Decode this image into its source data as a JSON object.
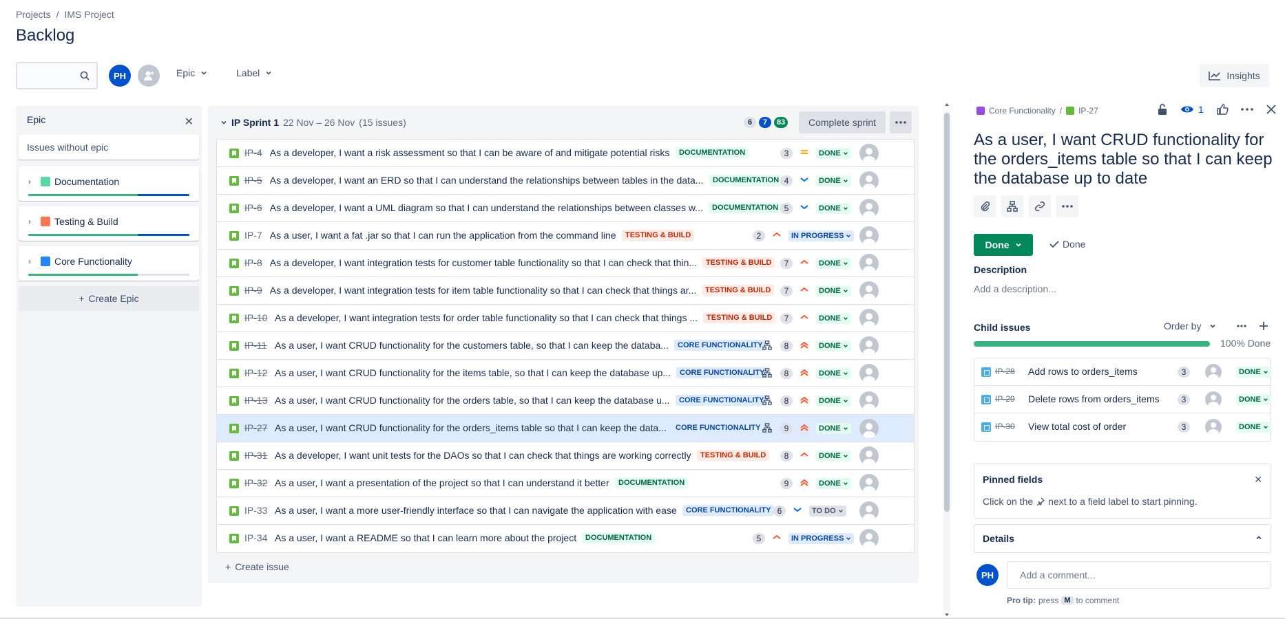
{
  "breadcrumb": {
    "projects": "Projects",
    "sep": "/",
    "project": "IMS Project"
  },
  "page_title": "Backlog",
  "toolbar": {
    "avatar_initials": "PH",
    "epic_filter": "Epic",
    "label_filter": "Label",
    "insights": "Insights"
  },
  "epic_panel": {
    "title": "Epic",
    "no_epic": "Issues without epic",
    "epics": [
      {
        "name": "Documentation",
        "color": "#57d9a3",
        "done": 0.68,
        "inprogress": 0.32
      },
      {
        "name": "Testing & Build",
        "color": "#ff7452",
        "done": 0.68,
        "inprogress": 0.32
      },
      {
        "name": "Core Functionality",
        "color": "#2684ff",
        "done": 0.68,
        "inprogress": 0.0
      }
    ],
    "create": "Create Epic"
  },
  "sprint": {
    "name": "IP Sprint 1",
    "dates": "22 Nov – 26 Nov",
    "count": "(15 issues)",
    "todo": "6",
    "inprogress": "7",
    "done": "83",
    "complete": "Complete sprint",
    "create_issue": "Create issue"
  },
  "issues": [
    {
      "key": "IP-4",
      "done": true,
      "summary": "As a developer, I want a risk assessment so that I can be aware of and mitigate potential risks",
      "epic": "DOCUMENTATION",
      "child": false,
      "points": "3",
      "prio": "medium",
      "status": "DONE"
    },
    {
      "key": "IP-5",
      "done": true,
      "summary": "As a developer, I want an ERD so that I can understand the relationships between tables in the data...",
      "epic": "DOCUMENTATION",
      "child": false,
      "points": "4",
      "prio": "low",
      "status": "DONE"
    },
    {
      "key": "IP-6",
      "done": true,
      "summary": "As a developer, I want a UML diagram so that I can understand the relationships between classes w...",
      "epic": "DOCUMENTATION",
      "child": false,
      "points": "5",
      "prio": "low",
      "status": "DONE"
    },
    {
      "key": "IP-7",
      "done": false,
      "summary": "As a user, I want a fat .jar so that I can run the application from the command line",
      "epic": "TESTING & BUILD",
      "child": false,
      "points": "2",
      "prio": "high",
      "status": "IN PROGRESS"
    },
    {
      "key": "IP-8",
      "done": true,
      "summary": "As a developer, I want integration tests for customer table functionality so that I can check that thin...",
      "epic": "TESTING & BUILD",
      "child": false,
      "points": "7",
      "prio": "high",
      "status": "DONE"
    },
    {
      "key": "IP-9",
      "done": true,
      "summary": "As a developer, I want integration tests for item table functionality so that I can check that things ar...",
      "epic": "TESTING & BUILD",
      "child": false,
      "points": "7",
      "prio": "high",
      "status": "DONE"
    },
    {
      "key": "IP-10",
      "done": true,
      "summary": "As a developer, I want integration tests for order table functionality so that I can check that things ...",
      "epic": "TESTING & BUILD",
      "child": false,
      "points": "7",
      "prio": "high",
      "status": "DONE"
    },
    {
      "key": "IP-11",
      "done": true,
      "summary": "As a user, I want CRUD functionality for the customers table, so that I can keep the databa...",
      "epic": "CORE FUNCTIONALITY",
      "child": true,
      "points": "8",
      "prio": "highest",
      "status": "DONE"
    },
    {
      "key": "IP-12",
      "done": true,
      "summary": "As a user, I want CRUD functionality for the items table, so that I can keep the database up...",
      "epic": "CORE FUNCTIONALITY",
      "child": true,
      "points": "8",
      "prio": "highest",
      "status": "DONE"
    },
    {
      "key": "IP-13",
      "done": true,
      "summary": "As a user, I want CRUD functionality for the orders table, so that I can keep the database u...",
      "epic": "CORE FUNCTIONALITY",
      "child": true,
      "points": "8",
      "prio": "highest",
      "status": "DONE"
    },
    {
      "key": "IP-27",
      "done": true,
      "summary": "As a user, I want CRUD functionality for the orders_items table so that I can keep the data...",
      "epic": "CORE FUNCTIONALITY",
      "child": true,
      "points": "9",
      "prio": "highest",
      "status": "DONE",
      "selected": true
    },
    {
      "key": "IP-31",
      "done": true,
      "summary": "As a developer, I want unit tests for the DAOs so that I can check that things are working correctly",
      "epic": "TESTING & BUILD",
      "child": false,
      "points": "8",
      "prio": "high",
      "status": "DONE"
    },
    {
      "key": "IP-32",
      "done": true,
      "summary": "As a user, I want a presentation of the project so that I can understand it better",
      "epic": "DOCUMENTATION",
      "child": false,
      "points": "9",
      "prio": "highest",
      "status": "DONE"
    },
    {
      "key": "IP-33",
      "done": false,
      "summary": "As a user, I want a more user-friendly interface so that I can navigate the application with ease",
      "epic": "CORE FUNCTIONALITY",
      "child": false,
      "points": "6",
      "prio": "low",
      "status": "TO DO"
    },
    {
      "key": "IP-34",
      "done": false,
      "summary": "As a user, I want a README so that I can learn more about the project",
      "epic": "DOCUMENTATION",
      "child": false,
      "points": "5",
      "prio": "high",
      "status": "IN PROGRESS"
    }
  ],
  "detail": {
    "epic": "Core Functionality",
    "sep": "/",
    "key": "IP-27",
    "watchers": "1",
    "title": "As a user, I want CRUD functionality for the orders_items table so that I can keep the database up to date",
    "status": "Done",
    "resolution": "Done",
    "description_label": "Description",
    "description_placeholder": "Add a description...",
    "child_issues_label": "Child issues",
    "order_by": "Order by",
    "progress": 1.0,
    "progress_label": "100% Done",
    "children": [
      {
        "key": "IP-28",
        "summary": "Add rows to orders_items",
        "points": "3",
        "status": "DONE"
      },
      {
        "key": "IP-29",
        "summary": "Delete rows from orders_items",
        "points": "3",
        "status": "DONE"
      },
      {
        "key": "IP-30",
        "summary": "View total cost of order",
        "points": "3",
        "status": "DONE"
      }
    ],
    "pinned_title": "Pinned fields",
    "pinned_text_pre": "Click on the",
    "pinned_text_post": "next to a field label to start pinning.",
    "details_title": "Details",
    "comment_avatar": "PH",
    "comment_placeholder": "Add a comment...",
    "protip_label": "Pro tip:",
    "protip_press": "press",
    "protip_key": "M",
    "protip_rest": "to comment"
  },
  "colors": {
    "DOCUMENTATION": {
      "bg": "#e3fcef",
      "fg": "#006644"
    },
    "TESTING & BUILD": {
      "bg": "#ffebe6",
      "fg": "#bf2600"
    },
    "CORE FUNCTIONALITY": {
      "bg": "#deebff",
      "fg": "#0747a6"
    },
    "DONE": {
      "bg": "#e3fcef",
      "fg": "#006644"
    },
    "IN PROGRESS": {
      "bg": "#deebff",
      "fg": "#0747a6"
    },
    "TO DO": {
      "bg": "#dfe1e6",
      "fg": "#42526e"
    }
  }
}
